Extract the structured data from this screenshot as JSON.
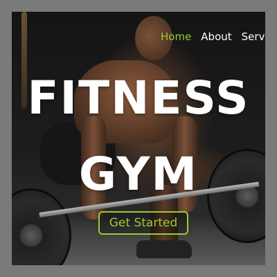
{
  "nav": {
    "items": [
      {
        "label": "Home",
        "active": true
      },
      {
        "label": "About",
        "active": false
      },
      {
        "label": "Service",
        "active": false
      }
    ]
  },
  "hero": {
    "line1": "FITNESS",
    "line2": "GYM",
    "cta_label": "Get Started",
    "background_image": "weightlifter-deadlift-photo"
  },
  "colors": {
    "accent": "#9acd32",
    "text": "#ffffff",
    "outer_background": "#7a7a7a"
  }
}
